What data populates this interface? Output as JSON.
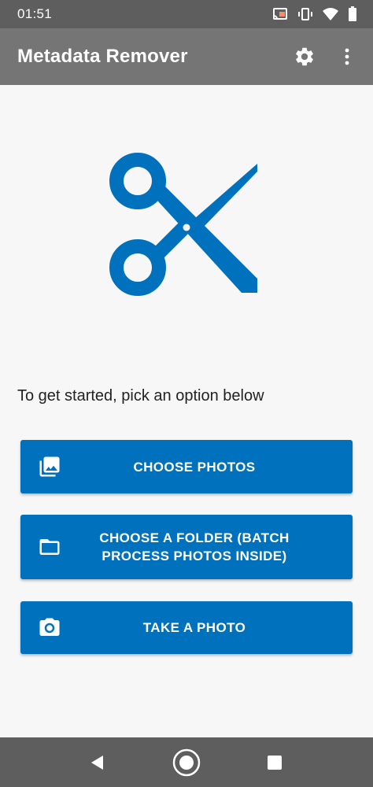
{
  "status_bar": {
    "time": "01:51",
    "icons": [
      "cast-icon",
      "vibrate-icon",
      "wifi-icon",
      "battery-icon"
    ]
  },
  "app_bar": {
    "title": "Metadata Remover",
    "actions": [
      "settings-icon",
      "more-vert-icon"
    ]
  },
  "hero": {
    "icon": "scissors-icon",
    "color": "#0072bd"
  },
  "prompt": "To get started, pick an option below",
  "buttons": [
    {
      "label": "CHOOSE PHOTOS",
      "icon": "photo-library-icon"
    },
    {
      "label": "CHOOSE A FOLDER (BATCH PROCESS PHOTOS INSIDE)",
      "icon": "folder-icon"
    },
    {
      "label": "TAKE A PHOTO",
      "icon": "camera-icon"
    }
  ],
  "nav_bar": {
    "buttons": [
      "back-icon",
      "home-icon",
      "recents-icon"
    ]
  },
  "colors": {
    "accent": "#0072bd",
    "app_bar": "#757575",
    "status_bar": "#5e5e5e",
    "background": "#f7f7f7"
  }
}
